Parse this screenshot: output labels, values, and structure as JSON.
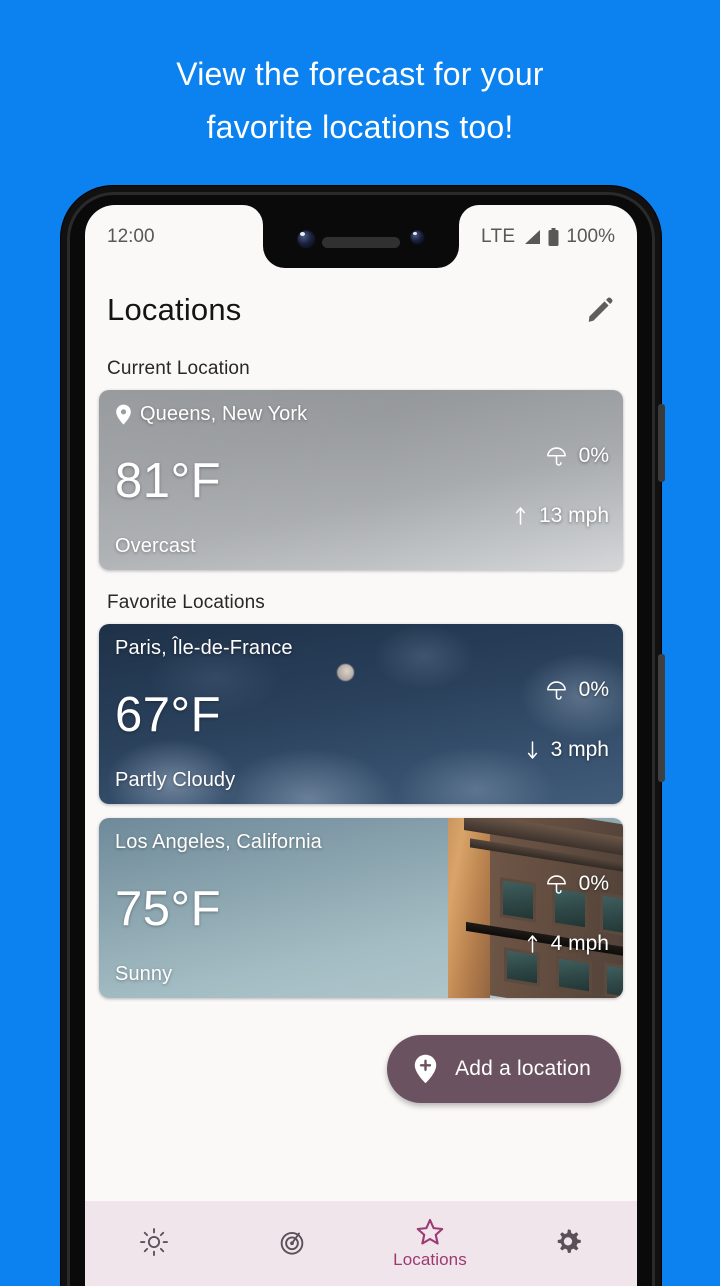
{
  "promo": {
    "lines": [
      "View the forecast for your",
      "favorite locations too!"
    ],
    "background_color": "#0b82f0",
    "text_color": "#ffffff"
  },
  "status_bar": {
    "time": "12:00",
    "network": "LTE",
    "signal_icon": "signal-bars-icon",
    "battery_icon": "battery-full-icon",
    "battery_level": "100%"
  },
  "app_header": {
    "title": "Locations",
    "edit_icon": "pencil-icon"
  },
  "sections": {
    "current_label": "Current Location",
    "favorites_label": "Favorite Locations"
  },
  "current_location": {
    "place": "Queens, New York",
    "pin_icon": "map-pin-icon",
    "temperature": "81°F",
    "condition": "Overcast",
    "precip_icon": "umbrella-icon",
    "precip": "0%",
    "wind_icon": "wind-direction-arrow-icon",
    "wind": "13 mph",
    "background": "overcast-grey-sky"
  },
  "favorites": [
    {
      "place": "Paris, Île-de-France",
      "temperature": "67°F",
      "condition": "Partly Cloudy",
      "precip_icon": "umbrella-icon",
      "precip": "0%",
      "wind_icon": "wind-direction-arrow-icon",
      "wind": "3 mph",
      "background": "night-cloudy-sky-with-moon"
    },
    {
      "place": "Los Angeles, California",
      "temperature": "75°F",
      "condition": "Sunny",
      "precip_icon": "umbrella-icon",
      "precip": "0%",
      "wind_icon": "wind-direction-arrow-icon",
      "wind": "4 mph",
      "background": "clear-sky-with-building"
    }
  ],
  "fab": {
    "label": "Add a location",
    "icon": "add-location-pin-icon",
    "color": "#6b5260"
  },
  "bottom_nav": {
    "items": [
      {
        "name": "today",
        "icon": "sun-icon",
        "label": "",
        "active": false
      },
      {
        "name": "radar",
        "icon": "radar-icon",
        "label": "",
        "active": false
      },
      {
        "name": "locations",
        "icon": "star-icon",
        "label": "Locations",
        "active": true
      },
      {
        "name": "settings",
        "icon": "gear-icon",
        "label": "",
        "active": false
      }
    ],
    "active_color": "#9c3a73",
    "background_color": "#f0e5ea"
  }
}
